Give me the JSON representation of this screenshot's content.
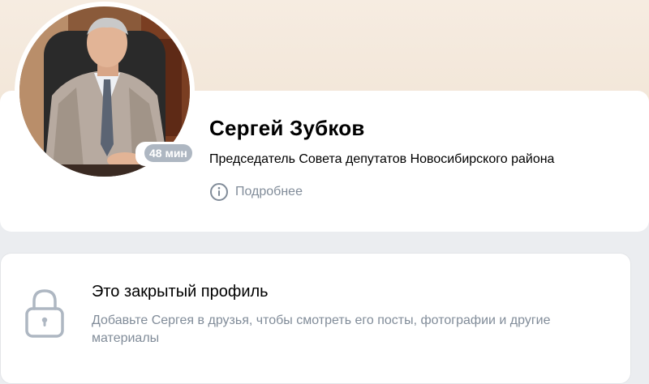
{
  "profile": {
    "name": "Сергей Зубков",
    "status": "Председатель Совета депутатов Новосибирского района",
    "online_badge": "48 мин",
    "more_label": "Подробнее"
  },
  "closed_profile": {
    "title": "Это закрытый профиль",
    "description": "Добавьте Сергея в друзья, чтобы смотреть его посты, фотографии и другие материалы"
  },
  "colors": {
    "cover": "#f6ece1",
    "badge": "#aeb7c2",
    "secondary_text": "#818c99",
    "page_bg": "#ebedf0"
  },
  "icons": {
    "info": "info-circle-icon",
    "lock": "lock-icon"
  }
}
